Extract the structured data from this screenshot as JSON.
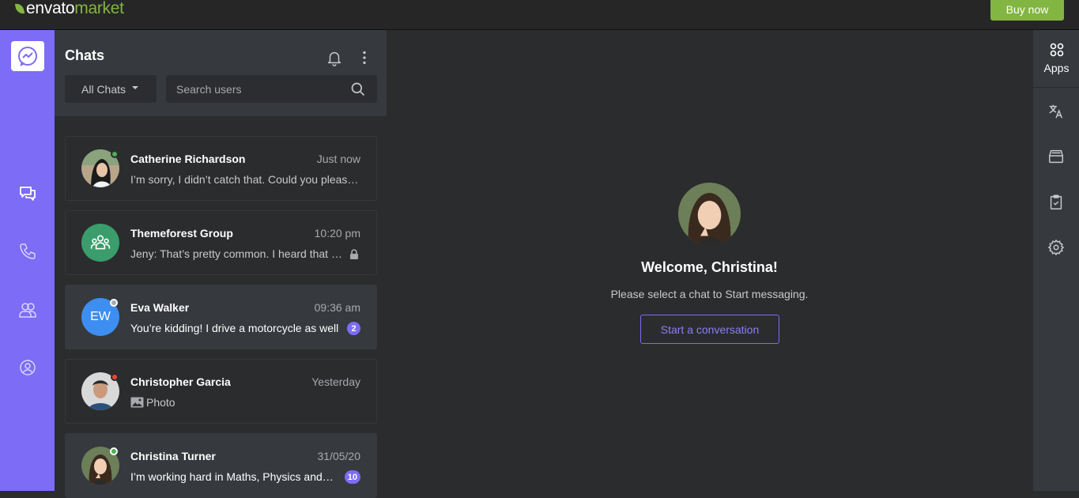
{
  "topbar": {
    "brand_main": "envato",
    "brand_sub": "market",
    "buy_label": "Buy now"
  },
  "rail": {
    "icons": [
      "messenger-logo-icon",
      "chats-icon",
      "phone-icon",
      "contacts-icon",
      "profile-icon"
    ]
  },
  "chats_panel": {
    "title": "Chats",
    "filter_label": "All Chats",
    "search_placeholder": "Search users",
    "items": [
      {
        "name": "Catherine Richardson",
        "time": "Just now",
        "message": "I’m sorry, I didn’t catch that. Could you please repeat?",
        "status": "online"
      },
      {
        "name": "Themeforest Group",
        "time": "10:20 pm",
        "message": "Jeny: That’s pretty common. I heard that a lot of people had the same experience.",
        "status": "group",
        "locked": true
      },
      {
        "name": "Eva Walker",
        "initials": "EW",
        "time": "09:36 am",
        "message": "You’re kidding! I drive a motorcycle as well",
        "status": "away",
        "unread": "2"
      },
      {
        "name": "Christopher Garcia",
        "time": "Yesterday",
        "message": "Photo",
        "status": "busy"
      },
      {
        "name": "Christina Turner",
        "time": "31/05/20",
        "message": "I’m working hard in Maths, Physics and Chemistry",
        "status": "online",
        "unread": "10"
      }
    ]
  },
  "main": {
    "welcome_title": "Welcome, Christina!",
    "welcome_sub": "Please select a chat to Start messaging.",
    "start_label": "Start a conversation"
  },
  "right_sidebar": {
    "apps_label": "Apps",
    "icons": [
      "apps-icon",
      "translate-icon",
      "archive-icon",
      "clipboard-check-icon",
      "settings-icon"
    ]
  },
  "colors": {
    "accent": "#7c6cf6",
    "envato_green": "#82b541",
    "online": "#4caf50",
    "busy": "#f44336",
    "group_avatar": "#3a9d6b",
    "ew_avatar": "#3d8ef0"
  }
}
